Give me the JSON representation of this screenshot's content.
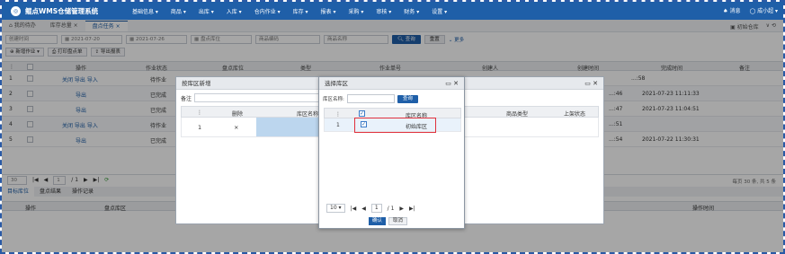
{
  "app": {
    "title": "鲲点WMS仓储管理系统",
    "logo_icon": "logo-icon"
  },
  "nav": {
    "menus": [
      "基础信息 ▾",
      "商品 ▾",
      "出库 ▾",
      "入库 ▾",
      "仓内作业 ▾",
      "库存 ▾",
      "报表 ▾",
      "采购 ▾",
      "审核 ▾",
      "财务 ▾",
      "设置 ▾"
    ],
    "message": "消息",
    "user": "成小超 ▾"
  },
  "tabs": {
    "items": [
      "我的待办",
      "库存总量 ×",
      "盘点任务 ×"
    ],
    "warehouse": "初始仓库",
    "right_icons": "∨  ⟲"
  },
  "filter": {
    "field1": "创建时间",
    "date_from": "2021-07-20",
    "date_to": "2021-07-26",
    "ph_loc": "盘点库位",
    "ph_code": "商品编码",
    "ph_name": "商品名称",
    "query": "查询",
    "reset": "重置",
    "more": "更多"
  },
  "toolbar": {
    "new": "新增作业 ▾",
    "print": "打印盘点单",
    "export": "导出报表"
  },
  "grid": {
    "headers": {
      "op": "操作",
      "status": "作业状态",
      "loc": "盘点库位",
      "type": "类型",
      "no": "作业单号",
      "creator": "创建人",
      "created": "创建时间",
      "done": "完成时间",
      "remark": "备注"
    },
    "rows": [
      {
        "idx": "1",
        "ops": "关闭  导出  导入",
        "status": "待作业",
        "created": "...:58",
        "done": ""
      },
      {
        "idx": "2",
        "ops": "导出",
        "status": "已完成",
        "created": "...:46",
        "done": "2021-07-23 11:11:33"
      },
      {
        "idx": "3",
        "ops": "导出",
        "status": "已完成",
        "created": "...:47",
        "done": "2021-07-23 11:04:51"
      },
      {
        "idx": "4",
        "ops": "关闭  导出  导入",
        "status": "待作业",
        "created": "...:51",
        "done": ""
      },
      {
        "idx": "5",
        "ops": "导出",
        "status": "已完成",
        "created": "...:54",
        "done": "2021-07-22 11:30:31"
      }
    ]
  },
  "pager": {
    "size": "30",
    "page": "1",
    "total": "/ 1",
    "summary": "每页 30 条, 共 5 条"
  },
  "subtabs": [
    "目标库位",
    "盘点结果",
    "操作记录"
  ],
  "subgrid": {
    "op": "操作",
    "loc": "盘点库区",
    "time": "操作时间"
  },
  "dialog1": {
    "title": "按库区新增",
    "note": "备注",
    "headers": {
      "idx": "",
      "del": "删除",
      "area": "库区名称",
      "goods_type": "商品类型",
      "shelf": "上架状态"
    },
    "row": {
      "idx": "1",
      "del": "×"
    }
  },
  "dialog2": {
    "title": "选择库区",
    "search_label": "库区名称:",
    "search_btn": "查询",
    "header": "库区名称",
    "row": {
      "idx": "1",
      "name": "初始库区"
    },
    "pager": {
      "size": "10 ▾",
      "page": "1",
      "total": "/ 1"
    },
    "ok": "确认",
    "cancel": "取消"
  }
}
